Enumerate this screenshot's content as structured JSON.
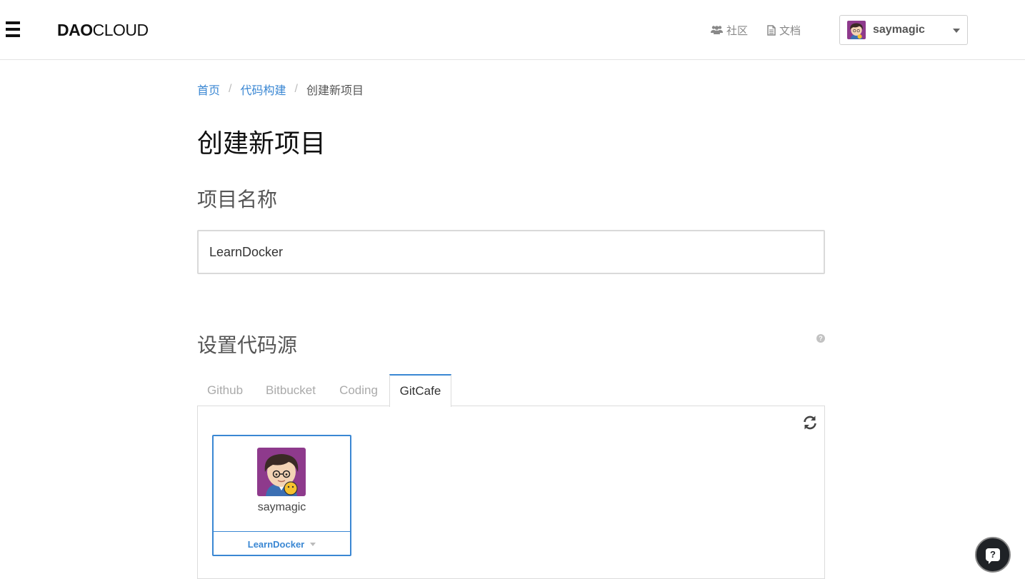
{
  "header": {
    "logo_bold": "DAO",
    "logo_light": "CLOUD",
    "nav": {
      "community": "社区",
      "docs": "文档"
    },
    "user": {
      "name": "saymagic"
    }
  },
  "breadcrumb": {
    "home": "首页",
    "builds": "代码构建",
    "current": "创建新项目",
    "separator": "/"
  },
  "page_title": "创建新项目",
  "project_name": {
    "label": "项目名称",
    "value": "LearnDocker"
  },
  "code_source": {
    "label": "设置代码源",
    "help": "?",
    "tabs": [
      {
        "label": "Github",
        "active": false
      },
      {
        "label": "Bitbucket",
        "active": false
      },
      {
        "label": "Coding",
        "active": false
      },
      {
        "label": "GitCafe",
        "active": true
      }
    ],
    "account": {
      "name": "saymagic",
      "repo": "LearnDocker"
    }
  },
  "help_fab": "?",
  "colors": {
    "accent": "#3a87d3",
    "avatar_bg": "#8e3a8c"
  }
}
